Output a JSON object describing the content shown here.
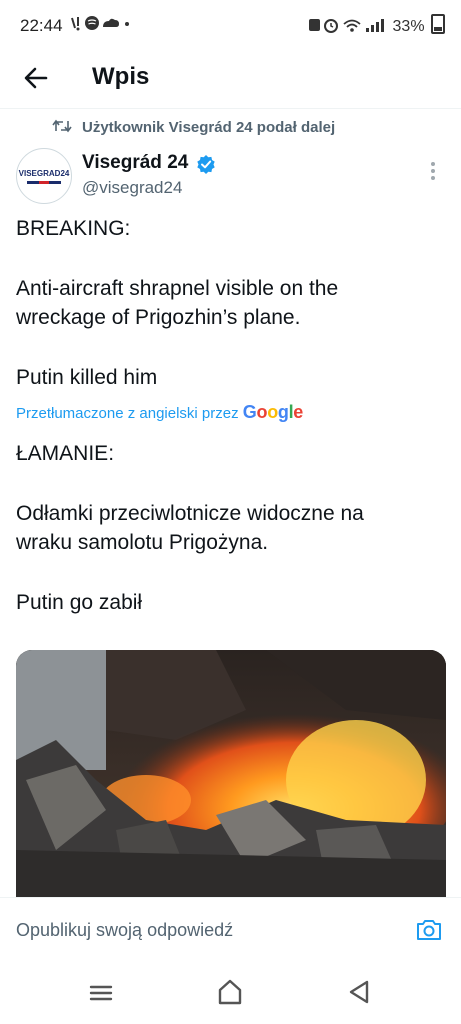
{
  "status_bar": {
    "time": "22:44",
    "battery": "33%"
  },
  "header": {
    "title": "Wpis"
  },
  "post": {
    "repost_text": "Użytkownik Visegrád 24 podał dalej",
    "avatar_text": "VISEGRAD24",
    "author_name": "Visegrád 24",
    "author_handle": "@visegrad24",
    "original": {
      "line1": "BREAKING:",
      "line2": "Anti-aircraft shrapnel visible on the",
      "line3": "wreckage of Prigozhin’s plane.",
      "line4": "Putin killed him"
    },
    "translated_label": "Przetłumaczone z angielski przez",
    "translated_brand": "Google",
    "translation": {
      "line1": "ŁAMANIE:",
      "line2": "Odłamki przeciwlotnicze widoczne na",
      "line3": "wraku samolotu Prigożyna.",
      "line4": "Putin go zabił"
    }
  },
  "reply": {
    "placeholder": "Opublikuj swoją odpowiedź"
  },
  "colors": {
    "accent": "#1d9bf0",
    "text": "#0f1419",
    "secondary": "#536471"
  }
}
